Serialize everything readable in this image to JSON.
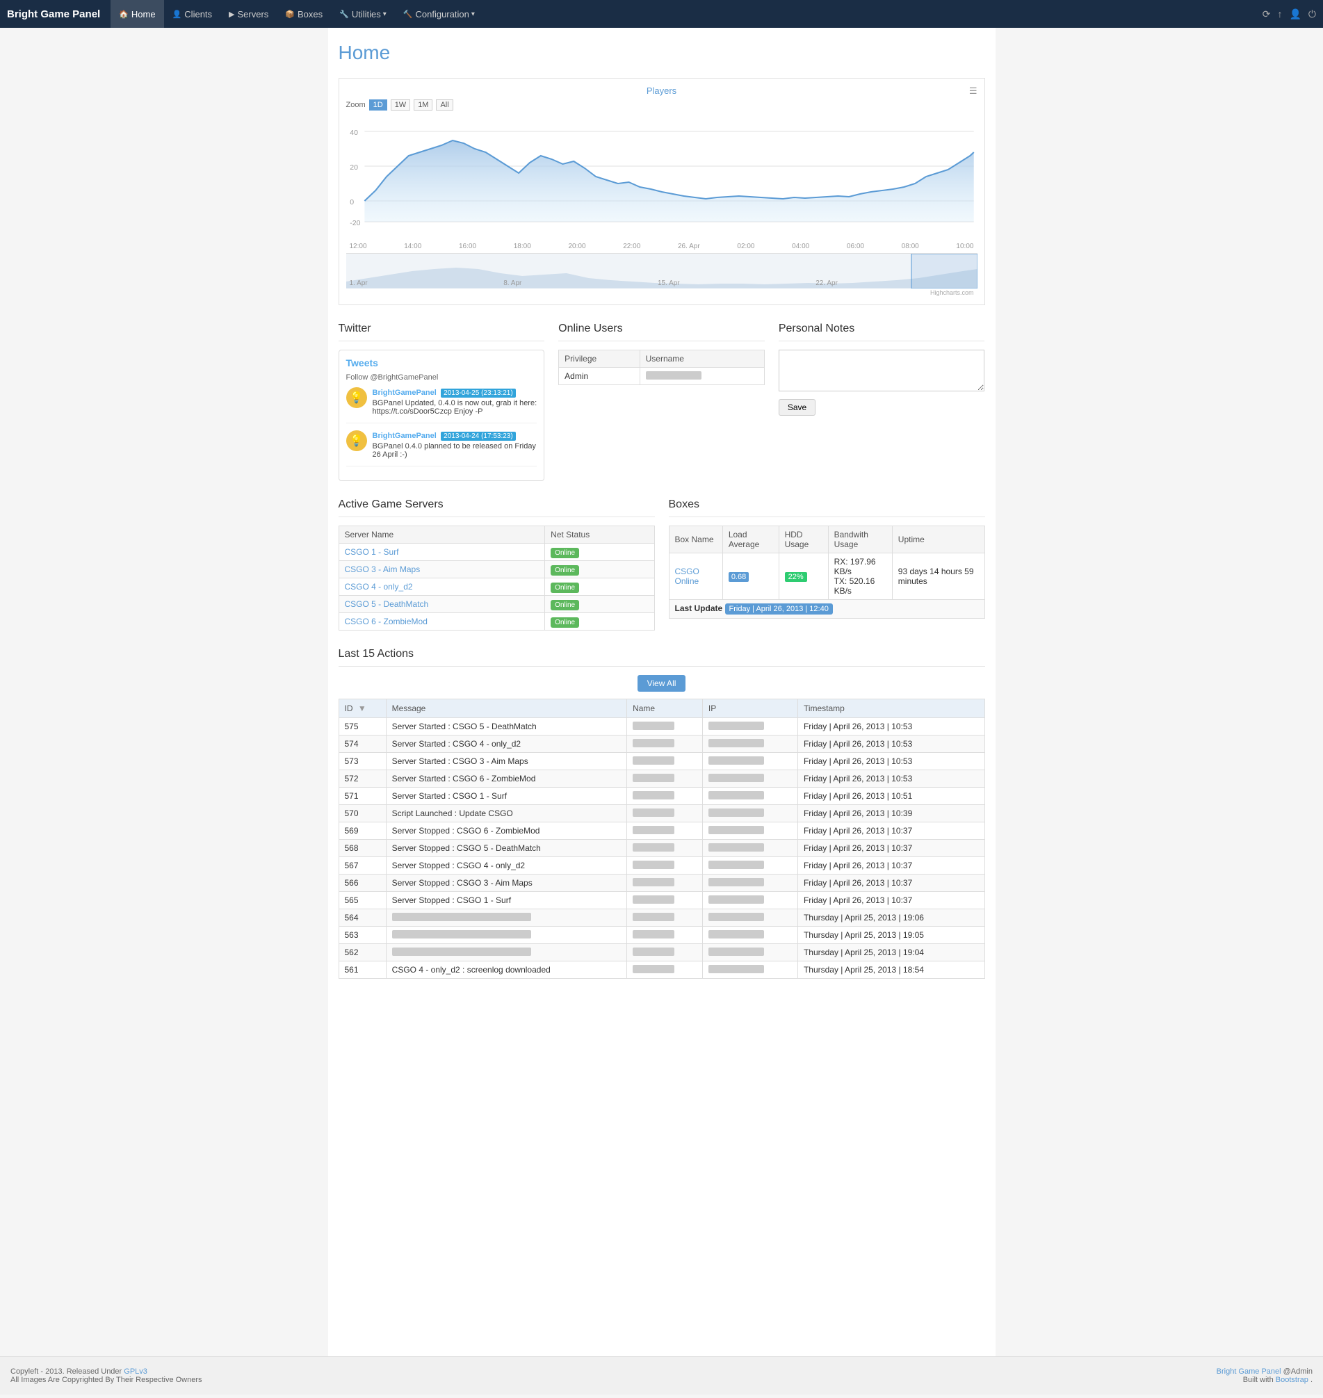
{
  "app": {
    "brand": "Bright Game Panel",
    "nav": [
      {
        "label": "Home",
        "icon": "🏠",
        "active": true
      },
      {
        "label": "Clients",
        "icon": "👤",
        "active": false
      },
      {
        "label": "Servers",
        "icon": "▶",
        "active": false
      },
      {
        "label": "Boxes",
        "icon": "📦",
        "active": false
      },
      {
        "label": "Utilities",
        "icon": "🔧",
        "active": false,
        "dropdown": true
      },
      {
        "label": "Configuration",
        "icon": "🔨",
        "active": false,
        "dropdown": true
      }
    ],
    "nav_right_icons": [
      "⟳",
      "↑",
      "👤",
      "⏻"
    ]
  },
  "page": {
    "title": "Home"
  },
  "chart": {
    "title": "Players",
    "zoom_label": "Zoom",
    "zoom_options": [
      "1D",
      "1W",
      "1M",
      "All"
    ],
    "zoom_active": "1D",
    "axis_labels": [
      "12:00",
      "14:00",
      "16:00",
      "18:00",
      "20:00",
      "22:00",
      "26. Apr",
      "02:00",
      "04:00",
      "06:00",
      "08:00",
      "10:00"
    ],
    "nav_labels": [
      "1. Apr",
      "8. Apr",
      "15. Apr",
      "22. Apr"
    ],
    "credit": "Highcharts.com"
  },
  "twitter": {
    "section_title": "Twitter",
    "tweets_header": "Tweets",
    "follow_text": "Follow @BrightGamePanel",
    "tweets": [
      {
        "author": "BrightGamePanel",
        "date": "2013-04-25 (23:13:21)",
        "text": "BGPanel Updated, 0.4.0 is now out, grab it here: https://t.co/sDoor5Czcp Enjoy -P",
        "link": "https://t.co/sDoor5Czcp"
      },
      {
        "author": "BrightGamePanel",
        "date": "2013-04-24 (17:53:23)",
        "text": "BGPanel 0.4.0 planned to be released on Friday 26 April :-)",
        "link": ""
      }
    ]
  },
  "online_users": {
    "section_title": "Online Users",
    "columns": [
      "Privilege",
      "Username"
    ],
    "rows": [
      {
        "privilege": "Admin",
        "username": ""
      }
    ]
  },
  "personal_notes": {
    "section_title": "Personal Notes",
    "textarea_placeholder": "",
    "save_label": "Save"
  },
  "active_servers": {
    "section_title": "Active Game Servers",
    "columns": [
      "Server Name",
      "Net Status"
    ],
    "rows": [
      {
        "name": "CSGO 1 - Surf",
        "status": "Online"
      },
      {
        "name": "CSGO 3 - Aim Maps",
        "status": "Online"
      },
      {
        "name": "CSGO 4 - only_d2",
        "status": "Online"
      },
      {
        "name": "CSGO 5 - DeathMatch",
        "status": "Online"
      },
      {
        "name": "CSGO 6 - ZombieMod",
        "status": "Online"
      }
    ]
  },
  "boxes": {
    "section_title": "Boxes",
    "columns": [
      "Box Name",
      "Load Average",
      "HDD Usage",
      "Bandwith Usage",
      "Uptime"
    ],
    "rows": [
      {
        "name": "CSGO Online",
        "load": "0.68",
        "hdd": "22%",
        "hdd_pct": 22,
        "bandwidth_rx": "RX: 197.96 KB/s",
        "bandwidth_tx": "TX: 520.16 KB/s",
        "uptime": "93 days 14 hours 59 minutes"
      }
    ],
    "last_update_label": "Last Update",
    "last_update_value": "Friday | April 26, 2013 | 12:40"
  },
  "actions": {
    "section_title": "Last 15 Actions",
    "view_all_label": "View All",
    "columns": [
      "ID",
      "Message",
      "Name",
      "IP",
      "Timestamp"
    ],
    "rows": [
      {
        "id": "575",
        "message": "Server Started : CSGO 5 - DeathMatch",
        "name": "",
        "ip": "",
        "timestamp": "Friday | April 26, 2013 | 10:53"
      },
      {
        "id": "574",
        "message": "Server Started : CSGO 4 - only_d2",
        "name": "",
        "ip": "",
        "timestamp": "Friday | April 26, 2013 | 10:53"
      },
      {
        "id": "573",
        "message": "Server Started : CSGO 3 - Aim Maps",
        "name": "",
        "ip": "",
        "timestamp": "Friday | April 26, 2013 | 10:53"
      },
      {
        "id": "572",
        "message": "Server Started : CSGO 6 - ZombieMod",
        "name": "",
        "ip": "",
        "timestamp": "Friday | April 26, 2013 | 10:53"
      },
      {
        "id": "571",
        "message": "Server Started : CSGO 1 - Surf",
        "name": "",
        "ip": "",
        "timestamp": "Friday | April 26, 2013 | 10:51"
      },
      {
        "id": "570",
        "message": "Script Launched : Update CSGO",
        "name": "",
        "ip": "",
        "timestamp": "Friday | April 26, 2013 | 10:39"
      },
      {
        "id": "569",
        "message": "Server Stopped : CSGO 6 - ZombieMod",
        "name": "",
        "ip": "",
        "timestamp": "Friday | April 26, 2013 | 10:37"
      },
      {
        "id": "568",
        "message": "Server Stopped : CSGO 5 - DeathMatch",
        "name": "",
        "ip": "",
        "timestamp": "Friday | April 26, 2013 | 10:37"
      },
      {
        "id": "567",
        "message": "Server Stopped : CSGO 4 - only_d2",
        "name": "",
        "ip": "",
        "timestamp": "Friday | April 26, 2013 | 10:37"
      },
      {
        "id": "566",
        "message": "Server Stopped : CSGO 3 - Aim Maps",
        "name": "",
        "ip": "",
        "timestamp": "Friday | April 26, 2013 | 10:37"
      },
      {
        "id": "565",
        "message": "Server Stopped : CSGO 1 - Surf",
        "name": "",
        "ip": "",
        "timestamp": "Friday | April 26, 2013 | 10:37"
      },
      {
        "id": "564",
        "message": "",
        "name": "",
        "ip": "",
        "timestamp": "Thursday | April 25, 2013 | 19:06"
      },
      {
        "id": "563",
        "message": "",
        "name": "",
        "ip": "",
        "timestamp": "Thursday | April 25, 2013 | 19:05"
      },
      {
        "id": "562",
        "message": "",
        "name": "",
        "ip": "",
        "timestamp": "Thursday | April 25, 2013 | 19:04"
      },
      {
        "id": "561",
        "message": "CSGO 4 - only_d2 : screenlog downloaded",
        "name": "",
        "ip": "",
        "timestamp": "Thursday | April 25, 2013 | 18:54"
      }
    ]
  },
  "footer": {
    "left_line1": "Copyleft - 2013. Released Under ",
    "license_link": "GPLv3",
    "license_url": "#",
    "left_line2": "All Images Are Copyrighted By Their Respective Owners",
    "right_line1": "Bright Game Panel",
    "right_user": " @Admin",
    "right_line2": "Built with ",
    "bootstrap_link": "Bootstrap",
    "period": "."
  }
}
